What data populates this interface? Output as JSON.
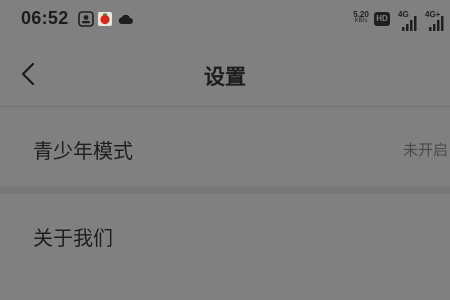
{
  "status_bar": {
    "time": "06:52",
    "notification_icons": [
      "notification-app-icon",
      "red-app-icon",
      "cloud-icon"
    ],
    "net_speed_value": "5.20",
    "net_speed_unit": "KB/s",
    "hd_label": "HD",
    "sim1_label": "4G",
    "sim2_label": "4G+"
  },
  "nav": {
    "back_icon": "chevron-left-icon",
    "title": "设置"
  },
  "settings": [
    {
      "label": "青少年模式",
      "value": "未开启"
    },
    {
      "label": "关于我们"
    }
  ]
}
